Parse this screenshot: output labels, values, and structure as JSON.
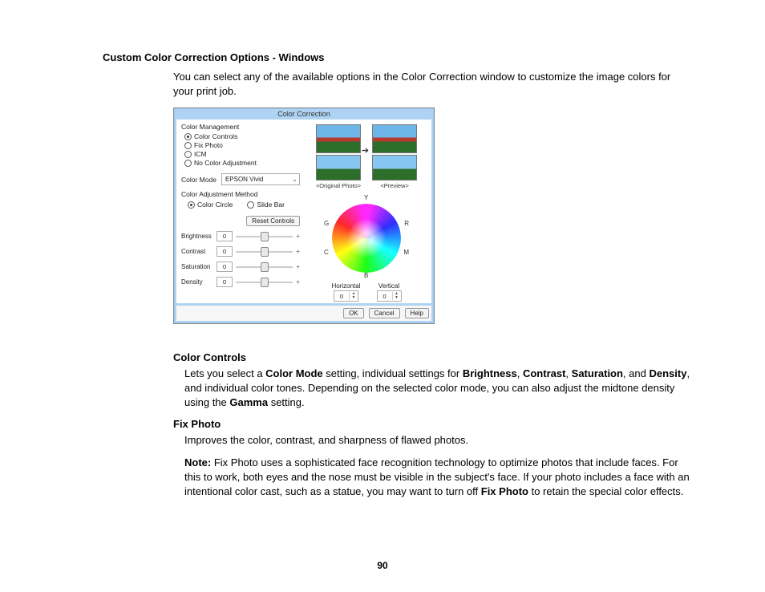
{
  "page": {
    "heading": "Custom Color Correction Options - Windows",
    "intro": "You can select any of the available options in the Color Correction window to customize the image colors for your print job.",
    "number": "90"
  },
  "dialog": {
    "title": "Color Correction",
    "mgmt_label": "Color Management",
    "opts": {
      "controls": "Color Controls",
      "fixphoto": "Fix Photo",
      "icm": "ICM",
      "none": "No Color Adjustment"
    },
    "mode_label": "Color Mode",
    "mode_value": "EPSON Vivid",
    "adj_label": "Color Adjustment Method",
    "adj_circle": "Color Circle",
    "adj_slide": "Slide Bar",
    "reset": "Reset Controls",
    "sliders": {
      "brightness": "Brightness",
      "contrast": "Contrast",
      "saturation": "Saturation",
      "density": "Density",
      "val": "0"
    },
    "preview": {
      "orig": "<Original Photo>",
      "prev": "<Preview>"
    },
    "wheel": {
      "Y": "Y",
      "R": "R",
      "M": "M",
      "B": "B",
      "C": "C",
      "G": "G"
    },
    "hv": {
      "h": "Horizontal",
      "v": "Vertical",
      "val": "0"
    },
    "buttons": {
      "ok": "OK",
      "cancel": "Cancel",
      "help": "Help"
    }
  },
  "body": {
    "cc_head": "Color Controls",
    "cc_t1": "Lets you select a ",
    "cc_b1": "Color Mode",
    "cc_t2": " setting, individual settings for ",
    "cc_b2": "Brightness",
    "cc_t3": ", ",
    "cc_b3": "Contrast",
    "cc_t4": ", ",
    "cc_b4": "Saturation",
    "cc_t5": ", and ",
    "cc_b5": "Density",
    "cc_t6": ", and individual color tones. Depending on the selected color mode, you can also adjust the midtone density using the ",
    "cc_b6": "Gamma",
    "cc_t7": " setting.",
    "fp_head": "Fix Photo",
    "fp_text": "Improves the color, contrast, and sharpness of flawed photos.",
    "note_b": "Note:",
    "note_t1": " Fix Photo uses a sophisticated face recognition technology to optimize photos that include faces. For this to work, both eyes and the nose must be visible in the subject's face. If your photo includes a face with an intentional color cast, such as a statue, you may want to turn off ",
    "note_b2": "Fix Photo",
    "note_t2": " to retain the special color effects."
  }
}
